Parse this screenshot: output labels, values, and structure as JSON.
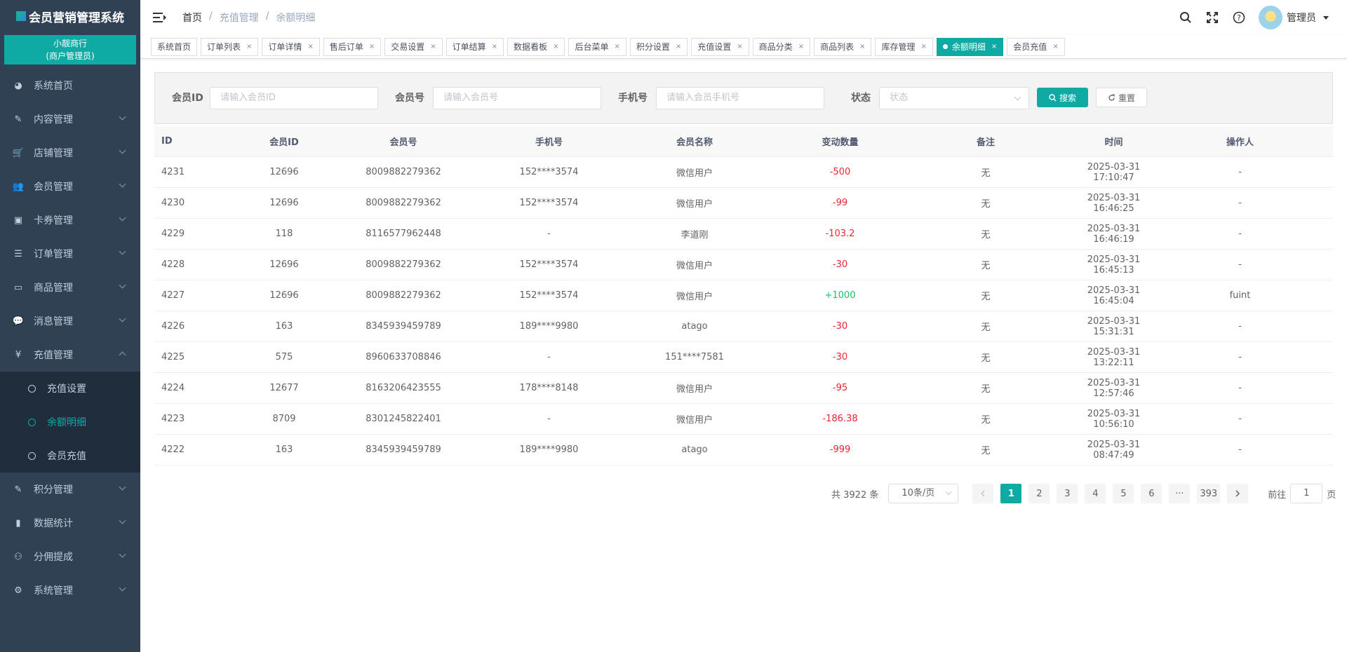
{
  "brand": {
    "title": "会员营销管理系统"
  },
  "store": {
    "name": "小靓商行",
    "role": "(商户管理员)"
  },
  "sidebar": {
    "items": [
      {
        "label": "系统首页",
        "icon": "dashboard-icon",
        "glyph": "◕"
      },
      {
        "label": "内容管理",
        "icon": "edit-icon",
        "glyph": "✎"
      },
      {
        "label": "店铺管理",
        "icon": "cart-icon",
        "glyph": "🛒"
      },
      {
        "label": "会员管理",
        "icon": "users-icon",
        "glyph": "👥"
      },
      {
        "label": "卡券管理",
        "icon": "coupon-icon",
        "glyph": "▣"
      },
      {
        "label": "订单管理",
        "icon": "list-icon",
        "glyph": "☰"
      },
      {
        "label": "商品管理",
        "icon": "monitor-icon",
        "glyph": "▭"
      },
      {
        "label": "消息管理",
        "icon": "message-icon",
        "glyph": "💬"
      },
      {
        "label": "充值管理",
        "icon": "yen-icon",
        "glyph": "¥"
      }
    ],
    "submenu": [
      {
        "label": "充值设置"
      },
      {
        "label": "余额明细"
      },
      {
        "label": "会员充值"
      }
    ],
    "items_after": [
      {
        "label": "积分管理",
        "icon": "edit-icon",
        "glyph": "✎"
      },
      {
        "label": "数据统计",
        "icon": "bar-chart-icon",
        "glyph": "▮"
      },
      {
        "label": "分佣提成",
        "icon": "org-icon",
        "glyph": "⚇"
      },
      {
        "label": "系统管理",
        "icon": "gear-icon",
        "glyph": "⚙"
      }
    ]
  },
  "breadcrumb": {
    "home": "首页",
    "sep": "/",
    "level2": "充值管理",
    "level3": "余额明细"
  },
  "header": {
    "user": "管理员"
  },
  "tags": [
    {
      "label": "系统首页",
      "closable": false
    },
    {
      "label": "订单列表",
      "closable": true
    },
    {
      "label": "订单详情",
      "closable": true
    },
    {
      "label": "售后订单",
      "closable": true
    },
    {
      "label": "交易设置",
      "closable": true
    },
    {
      "label": "订单结算",
      "closable": true
    },
    {
      "label": "数据看板",
      "closable": true
    },
    {
      "label": "后台菜单",
      "closable": true
    },
    {
      "label": "积分设置",
      "closable": true
    },
    {
      "label": "充值设置",
      "closable": true
    },
    {
      "label": "商品分类",
      "closable": true
    },
    {
      "label": "商品列表",
      "closable": true
    },
    {
      "label": "库存管理",
      "closable": true
    },
    {
      "label": "余额明细",
      "closable": true,
      "active": true
    },
    {
      "label": "会员充值",
      "closable": true
    }
  ],
  "filter": {
    "member_id_label": "会员ID",
    "member_id_placeholder": "请输入会员ID",
    "member_no_label": "会员号",
    "member_no_placeholder": "请输入会员号",
    "phone_label": "手机号",
    "phone_placeholder": "请输入会员手机号",
    "status_label": "状态",
    "status_placeholder": "状态",
    "search_label": "搜索",
    "reset_label": "重置"
  },
  "table": {
    "columns": [
      "ID",
      "会员ID",
      "会员号",
      "手机号",
      "会员名称",
      "变动数量",
      "备注",
      "时间",
      "操作人"
    ],
    "rows": [
      [
        "4231",
        "12696",
        "8009882279362",
        "152****3574",
        "微信用户",
        "-500",
        "无",
        "2025-03-31 17:10:47",
        "-"
      ],
      [
        "4230",
        "12696",
        "8009882279362",
        "152****3574",
        "微信用户",
        "-99",
        "无",
        "2025-03-31 16:46:25",
        "-"
      ],
      [
        "4229",
        "118",
        "8116577962448",
        "-",
        "李道刚",
        "-103.2",
        "无",
        "2025-03-31 16:46:19",
        "-"
      ],
      [
        "4228",
        "12696",
        "8009882279362",
        "152****3574",
        "微信用户",
        "-30",
        "无",
        "2025-03-31 16:45:13",
        "-"
      ],
      [
        "4227",
        "12696",
        "8009882279362",
        "152****3574",
        "微信用户",
        "+1000",
        "无",
        "2025-03-31 16:45:04",
        "fuint"
      ],
      [
        "4226",
        "163",
        "8345939459789",
        "189****9980",
        "atago",
        "-30",
        "无",
        "2025-03-31 15:31:31",
        "-"
      ],
      [
        "4225",
        "575",
        "8960633708846",
        "-",
        "151****7581",
        "-30",
        "无",
        "2025-03-31 13:22:11",
        "-"
      ],
      [
        "4224",
        "12677",
        "8163206423555",
        "178****8148",
        "微信用户",
        "-95",
        "无",
        "2025-03-31 12:57:46",
        "-"
      ],
      [
        "4223",
        "8709",
        "8301245822401",
        "-",
        "微信用户",
        "-186.38",
        "无",
        "2025-03-31 10:56:10",
        "-"
      ],
      [
        "4222",
        "163",
        "8345939459789",
        "189****9980",
        "atago",
        "-999",
        "无",
        "2025-03-31 08:47:49",
        "-"
      ]
    ]
  },
  "pagination": {
    "total": "共 3922 条",
    "page_size": "10条/页",
    "pages": [
      "1",
      "2",
      "3",
      "4",
      "5",
      "6",
      "···",
      "393"
    ],
    "current": "1",
    "goto_prefix": "前往",
    "goto_value": "1",
    "goto_suffix": "页"
  },
  "colors": {
    "accent": "#10aaa5",
    "sidebar_bg": "#304156",
    "submenu_bg": "#1f2d3d",
    "negative": "#f5222d",
    "positive": "#19be6b"
  }
}
